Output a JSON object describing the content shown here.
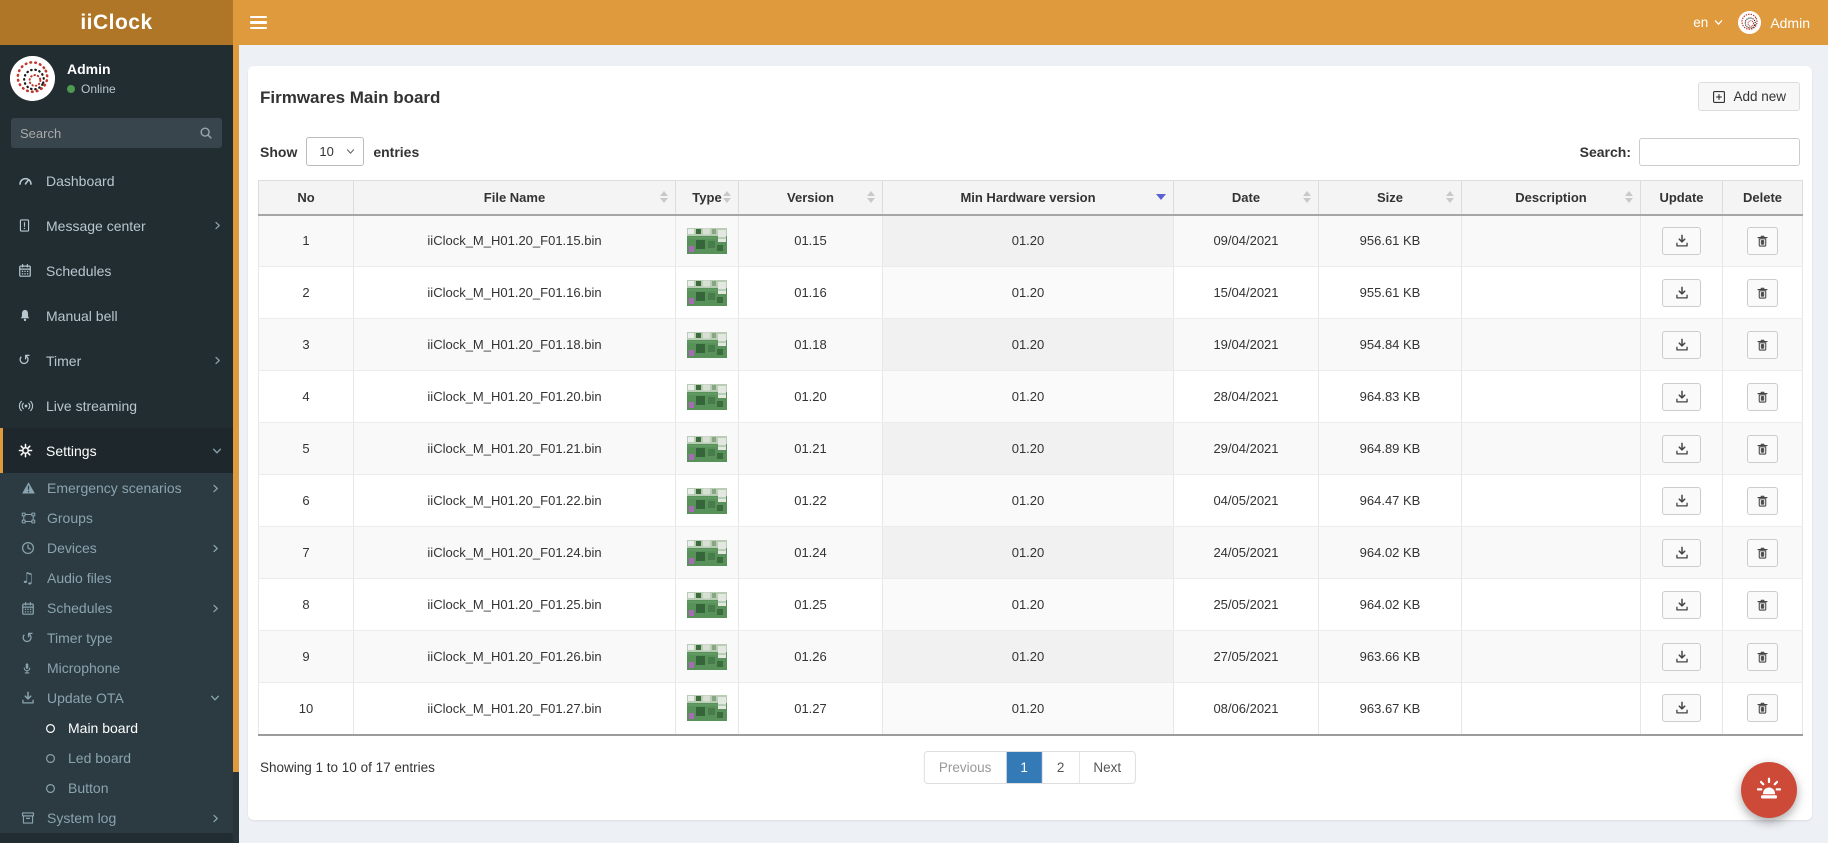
{
  "topbar": {
    "brand": "iiClock",
    "language": "en",
    "user": "Admin"
  },
  "sidebar": {
    "user_name": "Admin",
    "user_status": "Online",
    "search_placeholder": "Search",
    "menu": [
      {
        "label": "Dashboard",
        "icon": "gauge"
      },
      {
        "label": "Message center",
        "icon": "message",
        "chevron": "right"
      },
      {
        "label": "Schedules",
        "icon": "calendar"
      },
      {
        "label": "Manual bell",
        "icon": "bell"
      },
      {
        "label": "Timer",
        "icon": "history",
        "chevron": "right"
      },
      {
        "label": "Live streaming",
        "icon": "broadcast"
      },
      {
        "label": "Settings",
        "icon": "gear",
        "chevron": "down",
        "active": true
      }
    ],
    "settings_submenu": [
      {
        "label": "Emergency scenarios",
        "icon": "warning",
        "chevron": "right"
      },
      {
        "label": "Groups",
        "icon": "group"
      },
      {
        "label": "Devices",
        "icon": "clock",
        "chevron": "right"
      },
      {
        "label": "Audio files",
        "icon": "music"
      },
      {
        "label": "Schedules",
        "icon": "calendar",
        "chevron": "right"
      },
      {
        "label": "Timer type",
        "icon": "history"
      },
      {
        "label": "Microphone",
        "icon": "mic"
      },
      {
        "label": "Update OTA",
        "icon": "download",
        "chevron": "down",
        "expanded": true,
        "children": [
          {
            "label": "Main board",
            "active": true
          },
          {
            "label": "Led board"
          },
          {
            "label": "Button"
          }
        ]
      },
      {
        "label": "System log",
        "icon": "archive",
        "chevron": "right"
      }
    ]
  },
  "page": {
    "title": "Firmwares Main board",
    "add_new_label": "Add new",
    "show_label": "Show",
    "page_size": "10",
    "entries_label": "entries",
    "search_label": "Search:",
    "search_value": ""
  },
  "table": {
    "columns": [
      {
        "label": "No",
        "sort": "none"
      },
      {
        "label": "File Name",
        "sort": "both"
      },
      {
        "label": "Type",
        "sort": "both"
      },
      {
        "label": "Version",
        "sort": "both"
      },
      {
        "label": "Min Hardware version",
        "sort": "desc"
      },
      {
        "label": "Date",
        "sort": "both"
      },
      {
        "label": "Size",
        "sort": "both"
      },
      {
        "label": "Description",
        "sort": "both"
      },
      {
        "label": "Update",
        "sort": "none"
      },
      {
        "label": "Delete",
        "sort": "none"
      }
    ],
    "rows": [
      {
        "no": "1",
        "file_name": "iiClock_M_H01.20_F01.15.bin",
        "type_image": "pcb-thumbnail",
        "version": "01.15",
        "min_hw": "01.20",
        "date": "09/04/2021",
        "size": "956.61 KB",
        "description": ""
      },
      {
        "no": "2",
        "file_name": "iiClock_M_H01.20_F01.16.bin",
        "type_image": "pcb-thumbnail",
        "version": "01.16",
        "min_hw": "01.20",
        "date": "15/04/2021",
        "size": "955.61 KB",
        "description": ""
      },
      {
        "no": "3",
        "file_name": "iiClock_M_H01.20_F01.18.bin",
        "type_image": "pcb-thumbnail",
        "version": "01.18",
        "min_hw": "01.20",
        "date": "19/04/2021",
        "size": "954.84 KB",
        "description": ""
      },
      {
        "no": "4",
        "file_name": "iiClock_M_H01.20_F01.20.bin",
        "type_image": "pcb-thumbnail",
        "version": "01.20",
        "min_hw": "01.20",
        "date": "28/04/2021",
        "size": "964.83 KB",
        "description": ""
      },
      {
        "no": "5",
        "file_name": "iiClock_M_H01.20_F01.21.bin",
        "type_image": "pcb-thumbnail",
        "version": "01.21",
        "min_hw": "01.20",
        "date": "29/04/2021",
        "size": "964.89 KB",
        "description": ""
      },
      {
        "no": "6",
        "file_name": "iiClock_M_H01.20_F01.22.bin",
        "type_image": "pcb-thumbnail",
        "version": "01.22",
        "min_hw": "01.20",
        "date": "04/05/2021",
        "size": "964.47 KB",
        "description": ""
      },
      {
        "no": "7",
        "file_name": "iiClock_M_H01.20_F01.24.bin",
        "type_image": "pcb-thumbnail",
        "version": "01.24",
        "min_hw": "01.20",
        "date": "24/05/2021",
        "size": "964.02 KB",
        "description": ""
      },
      {
        "no": "8",
        "file_name": "iiClock_M_H01.20_F01.25.bin",
        "type_image": "pcb-thumbnail",
        "version": "01.25",
        "min_hw": "01.20",
        "date": "25/05/2021",
        "size": "964.02 KB",
        "description": ""
      },
      {
        "no": "9",
        "file_name": "iiClock_M_H01.20_F01.26.bin",
        "type_image": "pcb-thumbnail",
        "version": "01.26",
        "min_hw": "01.20",
        "date": "27/05/2021",
        "size": "963.66 KB",
        "description": ""
      },
      {
        "no": "10",
        "file_name": "iiClock_M_H01.20_F01.27.bin",
        "type_image": "pcb-thumbnail",
        "version": "01.27",
        "min_hw": "01.20",
        "date": "08/06/2021",
        "size": "963.67 KB",
        "description": ""
      }
    ]
  },
  "footer": {
    "showing": "Showing 1 to 10 of 17 entries",
    "previous_label": "Previous",
    "pages": [
      "1",
      "2"
    ],
    "active_page": "1",
    "next_label": "Next"
  },
  "icons": {
    "hamburger": "three-bars",
    "gauge": "speedometer",
    "message": "document-exclamation",
    "calendar": "calendar-grid",
    "bell": "bell",
    "history": "counterclockwise-arrow",
    "broadcast": "signal-waves",
    "gear": "cogwheel",
    "warning": "triangle-exclamation",
    "group": "object-group",
    "clock": "clock-face",
    "music": "music-note",
    "mic": "microphone",
    "download": "arrow-into-tray",
    "archive": "archive-box",
    "trash": "trash-can",
    "siren": "alarm-light",
    "search": "magnifier",
    "plus": "plus-square"
  },
  "colors": {
    "navbar": "#df9a3e",
    "logo_bg": "#b07628",
    "sidebar_bg": "#222d32",
    "submenu_bg": "#2c3b41",
    "active_item_border": "#df9a3e",
    "online_dot": "#4e9a51",
    "pagination_active": "#337ab7",
    "sort_active_arrow": "#5a61d2",
    "fab": "#cd4a38",
    "page_bg": "#edf0f5"
  }
}
